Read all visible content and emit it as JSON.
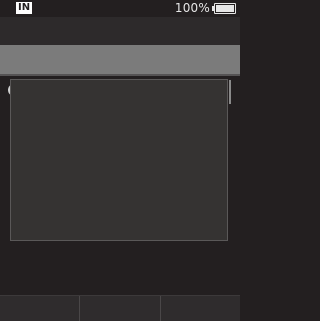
{
  "status_bar": {
    "ime_label": "IN",
    "battery_text": "100%",
    "battery_level": 1.0
  },
  "softkeys": [
    "",
    "",
    ""
  ],
  "colors": {
    "background": "#231f20",
    "band": "#7b7b7b",
    "panel": "#353332",
    "text": "#e6e6e6"
  }
}
